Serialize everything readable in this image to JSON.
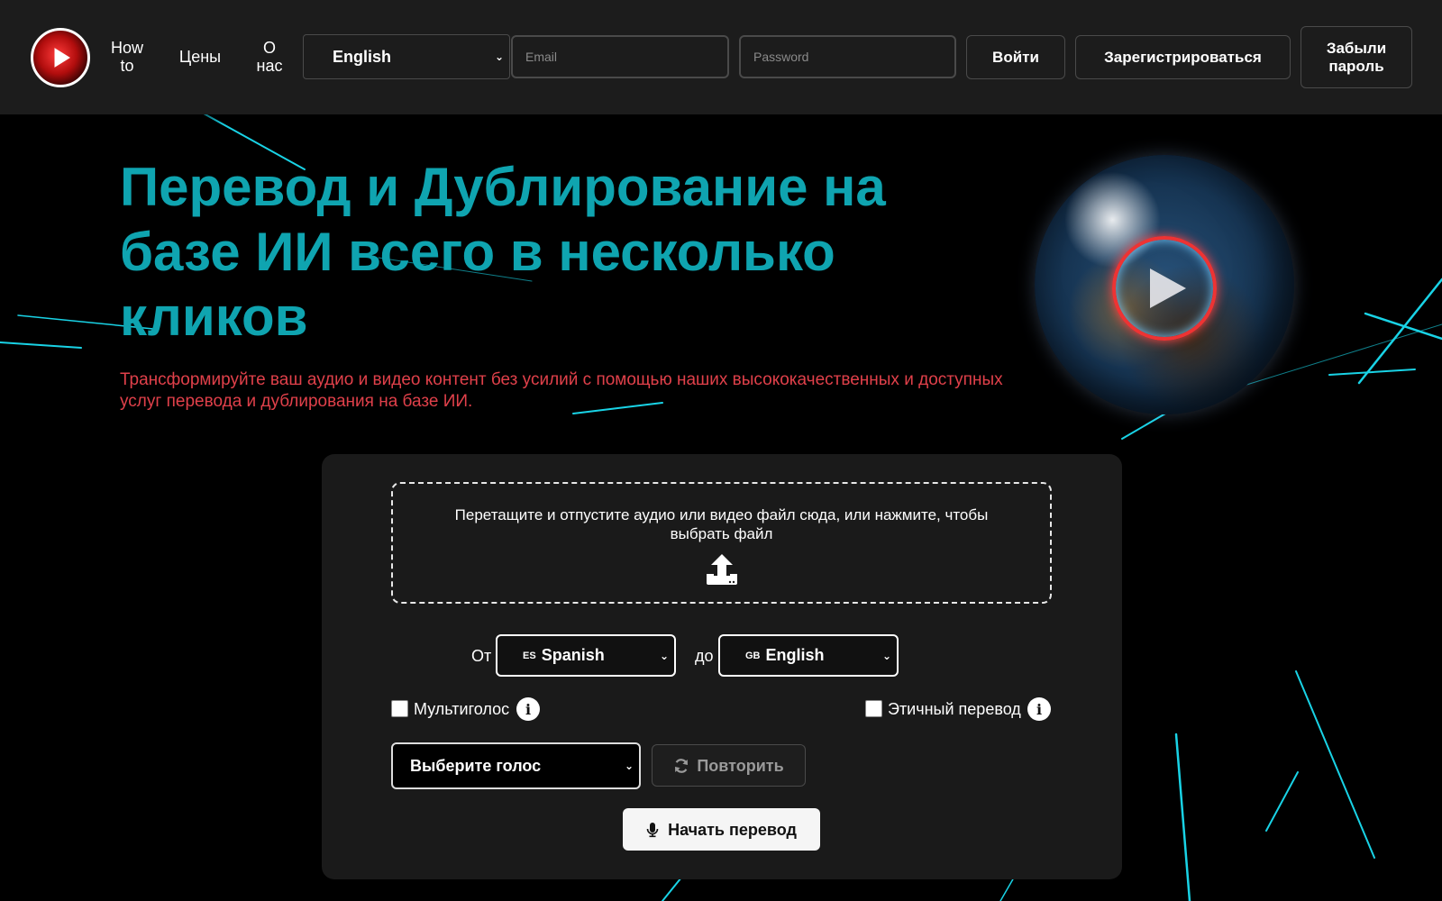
{
  "header": {
    "logo_name": "play-globe-logo",
    "nav": [
      {
        "label": "How\nto"
      },
      {
        "label": "Цены"
      },
      {
        "label": "О\nнас"
      }
    ],
    "language_select": {
      "value": "English"
    },
    "email": {
      "placeholder": "Email"
    },
    "password": {
      "placeholder": "Password"
    },
    "login_label": "Войти",
    "register_label": "Зарегистрироваться",
    "forgot_label": "Забыли\nпароль"
  },
  "hero": {
    "title": "Перевод и Дублирование на базе ИИ всего в несколько кликов",
    "subtitle": "Трансформируйте ваш аудио и видео контент без усилий с помощью наших высококачественных и доступных услуг перевода и дублирования на базе ИИ."
  },
  "translator": {
    "dropzone_text": "Перетащите и отпустите аудио или видео файл сюда, или нажмите, чтобы выбрать файл",
    "from_label": "От",
    "to_label": "до",
    "source_language": {
      "flag": "ES",
      "value": "Spanish"
    },
    "target_language": {
      "flag": "GB",
      "value": "English"
    },
    "multivoice_label": "Мультиголос",
    "multivoice_checked": false,
    "ethical_label": "Этичный перевод",
    "ethical_checked": false,
    "voice_select": {
      "value": "Выберите голос"
    },
    "repeat_label": "Повторить",
    "start_label": "Начать перевод"
  },
  "colors": {
    "accent_title": "#0fa4b0",
    "subtitle": "#e0404a",
    "streaks": "#19d3e6",
    "panel": "#1a1a1a",
    "header": "#1c1c1c"
  }
}
